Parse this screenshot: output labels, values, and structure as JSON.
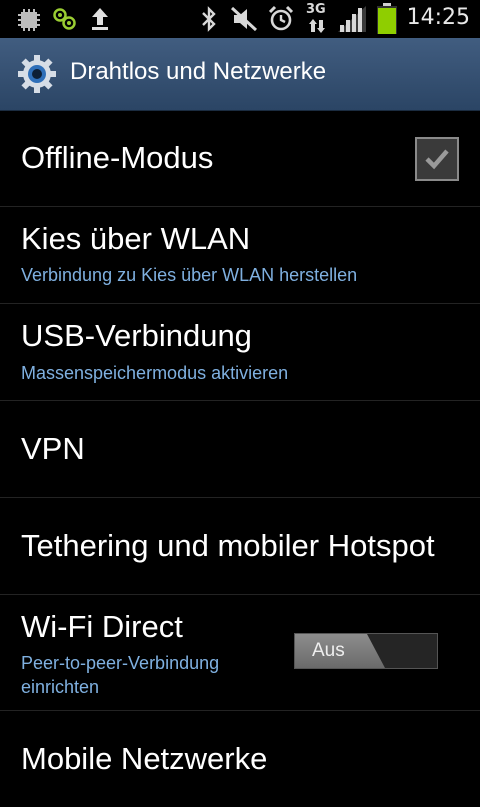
{
  "status_bar": {
    "icons": [
      "sim-icon",
      "usb-debug-icon",
      "upload-icon",
      "bluetooth-icon",
      "mute-icon",
      "alarm-icon",
      "3g-icon",
      "signal-icon",
      "battery-icon"
    ],
    "network_label": "3G",
    "time": "14:25"
  },
  "header": {
    "title": "Drahtlos und Netzwerke",
    "icon": "settings-gear-icon"
  },
  "items": [
    {
      "title": "Offline-Modus",
      "checked": true
    },
    {
      "title": "Kies über WLAN",
      "subtitle": "Verbindung zu Kies über WLAN herstellen"
    },
    {
      "title": "USB-Verbindung",
      "subtitle": "Massenspeichermodus aktivieren"
    },
    {
      "title": "VPN"
    },
    {
      "title": "Tethering und mobiler Hotspot"
    },
    {
      "title": "Wi-Fi Direct",
      "subtitle_line1": "Peer-to-peer-Verbindung",
      "subtitle_line2": "einrichten",
      "toggle_label": "Aus",
      "toggle_on": false
    },
    {
      "title": "Mobile Netzwerke"
    }
  ],
  "colors": {
    "header_bg": "#34506f",
    "subtitle": "#7fb0e0",
    "divider": "#232323"
  }
}
